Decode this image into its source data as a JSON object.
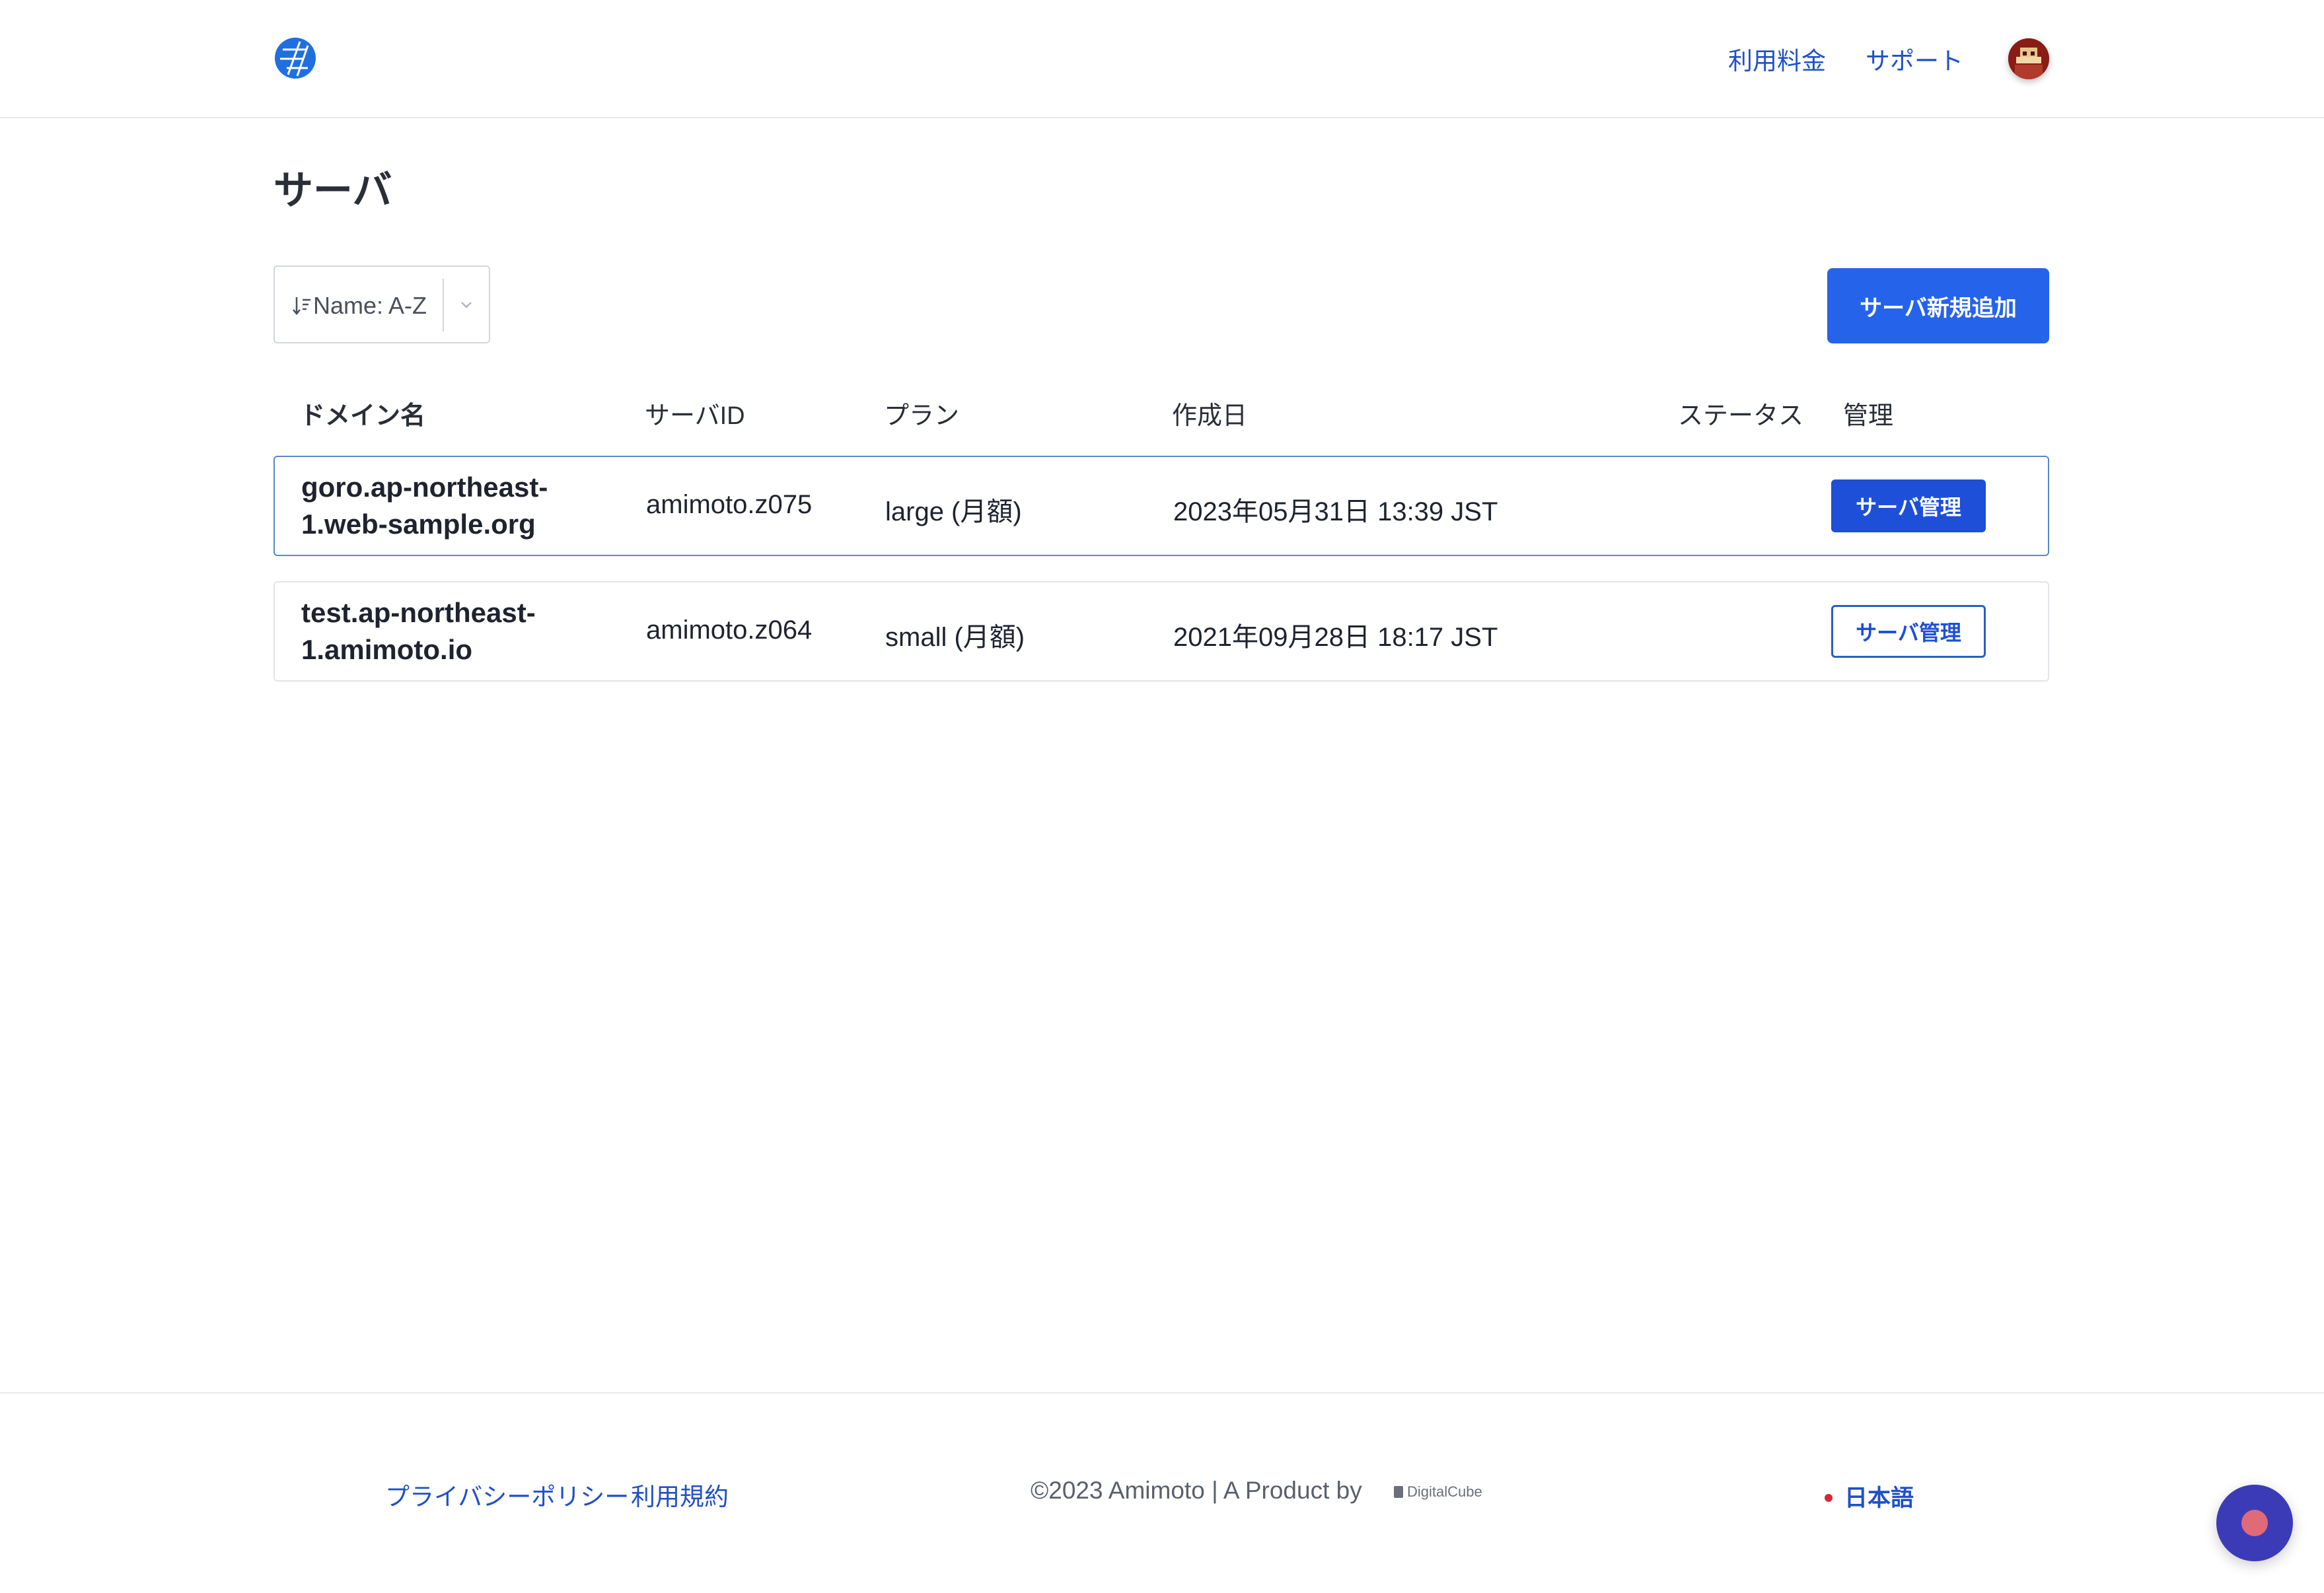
{
  "header": {
    "logo_icon": "amimoto-logo-icon",
    "nav": [
      {
        "label": "利用料金"
      },
      {
        "label": "サポート"
      }
    ],
    "avatar_icon": "user-avatar-icon"
  },
  "main": {
    "title": "サーバ",
    "sort": {
      "value": "Name: A-Z",
      "icon": "sort-icon"
    },
    "add_button_label": "サーバ新規追加",
    "table": {
      "headers": [
        "ドメイン名",
        "サーバID",
        "プラン",
        "作成日",
        "ステータス",
        "管理"
      ],
      "rows": [
        {
          "domain": "goro.ap-northeast-1.web-sample.org",
          "server_id": "amimoto.z075",
          "plan": "large (月額)",
          "created": "2023年05月31日 13:39 JST",
          "status": "",
          "action_label": "サーバ管理"
        },
        {
          "domain": "test.ap-northeast-1.amimoto.io",
          "server_id": "amimoto.z064",
          "plan": "small (月額)",
          "created": "2021年09月28日 18:17 JST",
          "status": "",
          "action_label": "サーバ管理"
        }
      ]
    }
  },
  "footer": {
    "privacy": "プライバシーポリシー",
    "terms": "利用規約",
    "copyright": "©2023 Amimoto | A Product by",
    "brand": "DigitalCube",
    "language": "日本語"
  },
  "colors": {
    "accent": "#2563eb",
    "link": "#2050c8",
    "lang_dot": "#d9263a",
    "chat": "#3b3bb8"
  }
}
